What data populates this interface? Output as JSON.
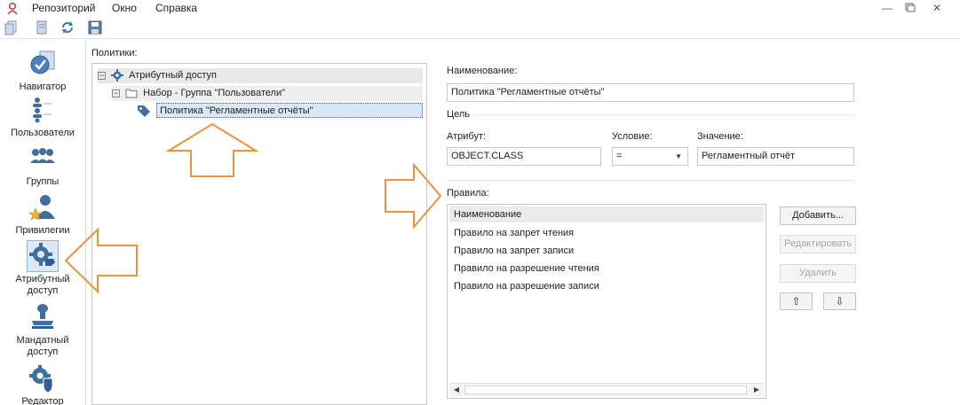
{
  "menu": {
    "items": [
      "Репозиторий",
      "Окно",
      "Справка"
    ]
  },
  "window_controls": {
    "minimize_icon": "minimize-icon",
    "restore_icon": "restore-icon",
    "close_icon": "close-icon"
  },
  "toolbar": {
    "icons": [
      "new-document-icon",
      "copy-document-icon",
      "refresh-icon",
      "save-icon"
    ]
  },
  "nav": {
    "items": [
      {
        "label": "Навигатор",
        "icon": "navigator-icon"
      },
      {
        "label": "Пользователи",
        "icon": "users-icon"
      },
      {
        "label": "Группы",
        "icon": "groups-icon"
      },
      {
        "label": "Привилегии",
        "icon": "privileges-icon"
      },
      {
        "label": "Атрибутный доступ",
        "icon": "attribute-access-icon",
        "active": true
      },
      {
        "label": "Мандатный доступ",
        "icon": "mandatory-access-icon"
      },
      {
        "label": "Редактор",
        "icon": "editor-icon"
      }
    ]
  },
  "policies": {
    "label": "Политики:",
    "tree": {
      "root": "Атрибутный доступ",
      "set": "Набор - Группа \"Пользователи\"",
      "policy": "Политика \"Регламентные отчёты\""
    }
  },
  "form": {
    "name_label": "Наименование:",
    "name_value": "Политика \"Регламентные отчёты\"",
    "target_label": "Цель",
    "attribute_label": "Атрибут:",
    "attribute_value": "OBJECT.CLASS",
    "condition_label": "Условие:",
    "condition_value": "=",
    "value_label": "Значение:",
    "value_value": "Регламентный отчёт",
    "rules_label": "Правила:"
  },
  "rules": {
    "header": "Наименование",
    "rows": [
      "Правило на запрет чтения",
      "Правило на запрет записи",
      "Правило на разрешение чтения",
      "Правило на разрешение записи"
    ]
  },
  "buttons": {
    "add": "Добавить...",
    "edit": "Редактировать",
    "delete": "Удалить",
    "up_icon": "arrow-up-icon",
    "down_icon": "arrow-down-icon"
  },
  "colors": {
    "highlight_arrow": "#f0913a",
    "selection": "#d9e8f7",
    "accent_blue": "#3a78b8"
  }
}
